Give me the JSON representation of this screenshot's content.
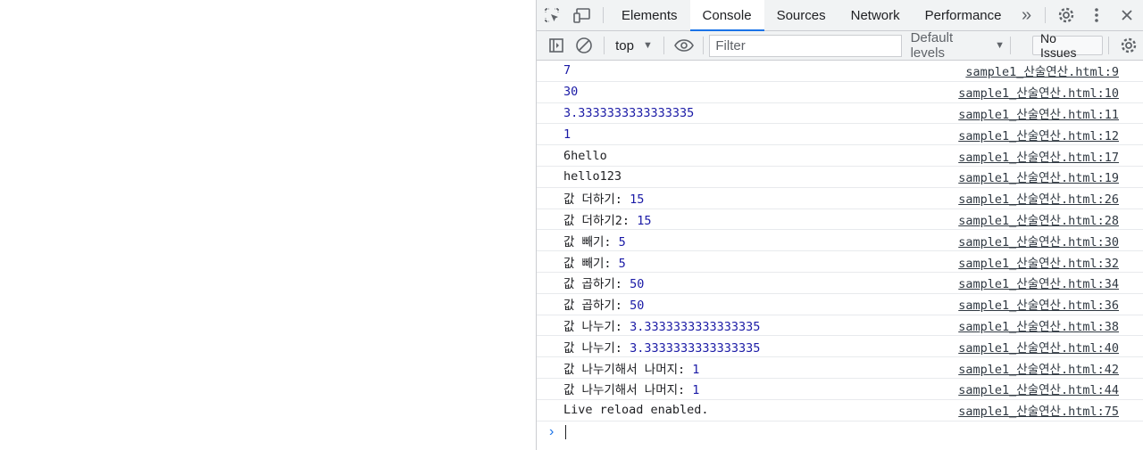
{
  "devtools": {
    "tabs": [
      {
        "label": "Elements"
      },
      {
        "label": "Console"
      },
      {
        "label": "Sources"
      },
      {
        "label": "Network"
      },
      {
        "label": "Performance"
      }
    ],
    "active_tab": "Console"
  },
  "toolbar": {
    "context": "top",
    "filter_placeholder": "Filter",
    "levels_label": "Default levels",
    "issues_label": "No Issues"
  },
  "console": {
    "messages": [
      {
        "text": "",
        "value": "7",
        "source": "sample1_산술연산.html:9"
      },
      {
        "text": "",
        "value": "30",
        "source": "sample1_산술연산.html:10"
      },
      {
        "text": "",
        "value": "3.3333333333333335",
        "source": "sample1_산술연산.html:11"
      },
      {
        "text": "",
        "value": "1",
        "source": "sample1_산술연산.html:12"
      },
      {
        "text": "6hello",
        "value": "",
        "source": "sample1_산술연산.html:17"
      },
      {
        "text": "hello123",
        "value": "",
        "source": "sample1_산술연산.html:19"
      },
      {
        "text": "값 더하기: ",
        "value": "15",
        "source": "sample1_산술연산.html:26"
      },
      {
        "text": "값 더하기2: ",
        "value": "15",
        "source": "sample1_산술연산.html:28"
      },
      {
        "text": "값 빼기: ",
        "value": "5",
        "source": "sample1_산술연산.html:30"
      },
      {
        "text": "값 빼기: ",
        "value": "5",
        "source": "sample1_산술연산.html:32"
      },
      {
        "text": "값 곱하기: ",
        "value": "50",
        "source": "sample1_산술연산.html:34"
      },
      {
        "text": "값 곱하기: ",
        "value": "50",
        "source": "sample1_산술연산.html:36"
      },
      {
        "text": "값 나누기: ",
        "value": "3.3333333333333335",
        "source": "sample1_산술연산.html:38"
      },
      {
        "text": "값 나누기: ",
        "value": "3.3333333333333335",
        "source": "sample1_산술연산.html:40"
      },
      {
        "text": "값 나누기해서 나머지: ",
        "value": "1",
        "source": "sample1_산술연산.html:42"
      },
      {
        "text": "값 나누기해서 나머지: ",
        "value": "1",
        "source": "sample1_산술연산.html:44"
      },
      {
        "text": "Live reload enabled.",
        "value": "",
        "source": "sample1_산술연산.html:75"
      }
    ]
  },
  "colors": {
    "accent": "#1a73e8",
    "number": "#1a1aa6"
  }
}
